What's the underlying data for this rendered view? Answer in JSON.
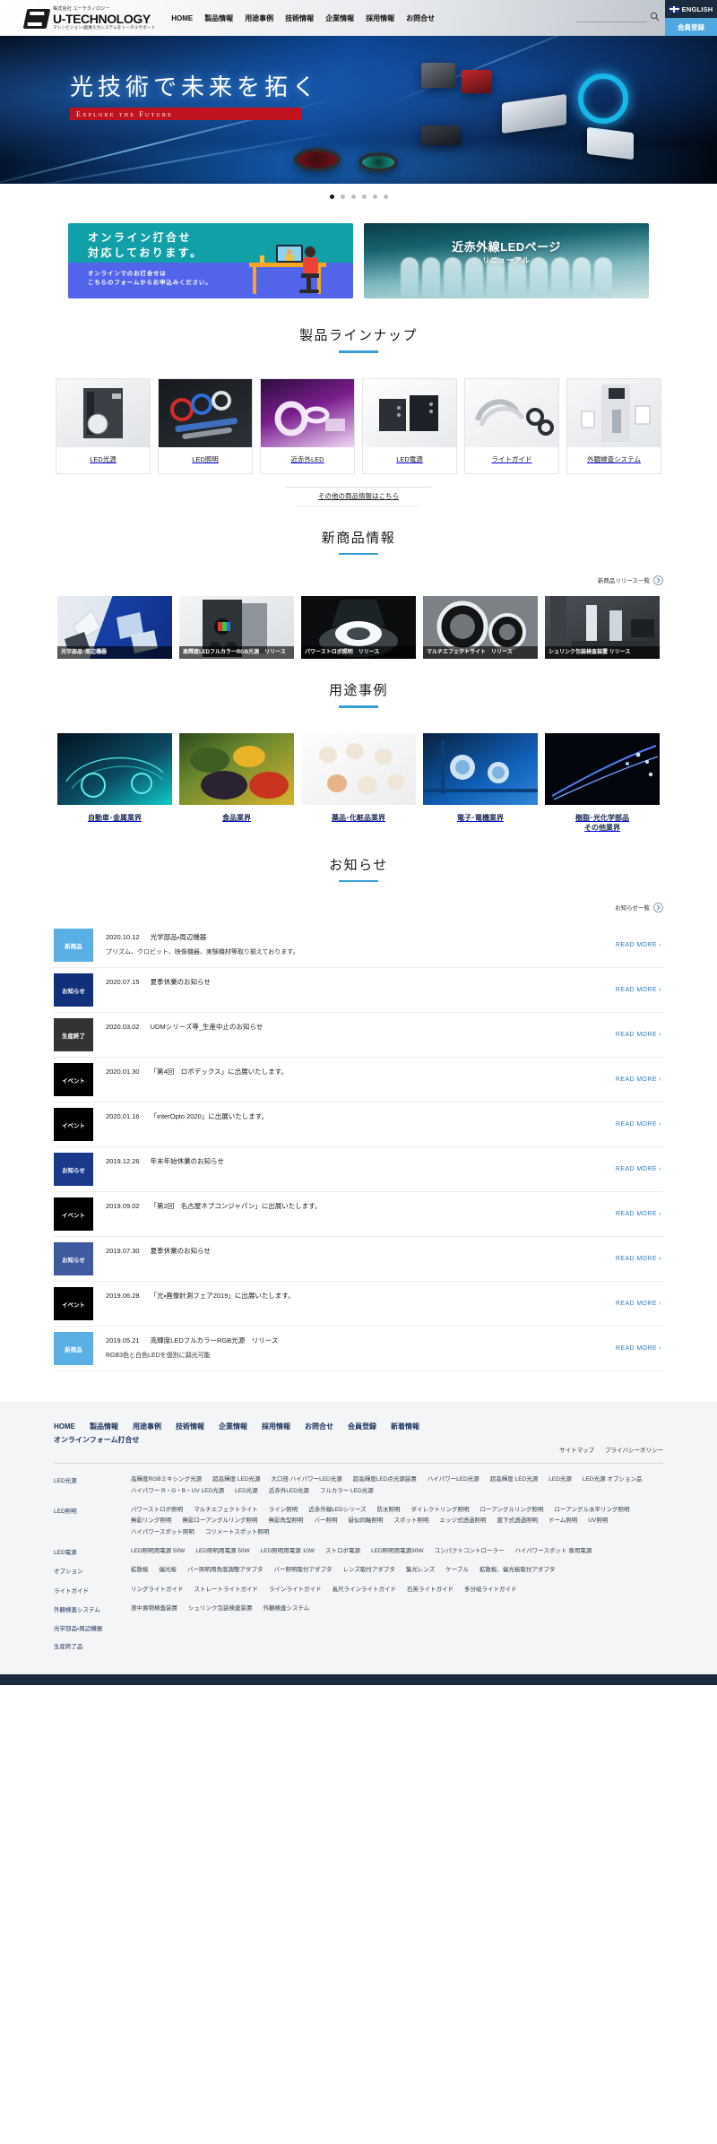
{
  "header": {
    "logo": {
      "kana": "株式会社 ユーテクノロジー",
      "name": "U-TECHNOLOGY",
      "tagline": "マシンビジョン・画像入力システムをトータルサポート"
    },
    "nav": [
      "HOME",
      "製品情報",
      "用途事例",
      "技術情報",
      "企業情報",
      "採用情報",
      "お問合せ"
    ],
    "search": {
      "value": "",
      "placeholder": ""
    },
    "english_label": "ENGLISH",
    "member_label": "会員登録"
  },
  "hero": {
    "title": "光技術で未来を拓く",
    "subtitle": "Explore the Future",
    "slide_count": 6,
    "active_slide": 1
  },
  "banners": [
    {
      "title_line1": "オンライン打合せ",
      "title_line2": "対応しております。",
      "sub_line1": "オンラインでのお打合せは",
      "sub_line2": "こちらのフォームからお申込みください。",
      "color_top": "#12a0a8",
      "color_bottom": "#5264ea"
    },
    {
      "title": "近赤外線LEDページ",
      "subtitle": "リニューアル"
    }
  ],
  "product_lineup": {
    "heading": "製品ラインナップ",
    "items": [
      {
        "label": "LED光源"
      },
      {
        "label": "LED照明"
      },
      {
        "label": "近赤外LED"
      },
      {
        "label": "LED電源"
      },
      {
        "label": "ライトガイド"
      },
      {
        "label": "外観検査システム"
      }
    ],
    "more_label": "その他の商品情報はこちら"
  },
  "new_products": {
    "heading": "新商品情報",
    "list_link": "新商品リリース一覧",
    "items": [
      {
        "caption": "光学部品･周辺機器"
      },
      {
        "caption": "高輝度LEDフルカラーRGB光源　リリース"
      },
      {
        "caption": "パワーストロボ照明　リリース"
      },
      {
        "caption": "マルチエフェクトライト　リリース"
      },
      {
        "caption": "シュリンク包装検査装置 リリース"
      }
    ]
  },
  "use_cases": {
    "heading": "用途事例",
    "items": [
      {
        "label": "自動車･金属業界"
      },
      {
        "label": "食品業界"
      },
      {
        "label": "薬品･化粧品業界"
      },
      {
        "label": "電子･電機業界"
      },
      {
        "label": "樹脂･光化学部品\nその他業界"
      }
    ]
  },
  "news": {
    "heading": "お知らせ",
    "list_link": "お知らせ一覧",
    "read_more": "READ MORE ›",
    "items": [
      {
        "badge": "新商品",
        "badge_color": "#5ab0e4",
        "date": "2020.10.12",
        "title": "光学部品・周辺機器",
        "desc": "プリズム、クロビット、映像機器、実験機材等取り揃えております。"
      },
      {
        "badge": "お知らせ",
        "badge_color": "#10307a",
        "date": "2020.07.15",
        "title": "夏季休業のお知らせ",
        "desc": ""
      },
      {
        "badge": "生産終了",
        "badge_color": "#333333",
        "date": "2020.03.02",
        "title": "UDMシリーズ等_生産中止のお知らせ",
        "desc": ""
      },
      {
        "badge": "イベント",
        "badge_color": "#000000",
        "date": "2020.01.30",
        "title": "「第4回　ロボデックス」に出展いたします。",
        "desc": ""
      },
      {
        "badge": "イベント",
        "badge_color": "#000000",
        "date": "2020.01.16",
        "title": "「interOpto 2020」に出展いたします。",
        "desc": ""
      },
      {
        "badge": "お知らせ",
        "badge_color": "#1b3a8c",
        "date": "2019.12.26",
        "title": "年末年始休業のお知らせ",
        "desc": ""
      },
      {
        "badge": "イベント",
        "badge_color": "#000000",
        "date": "2019.09.02",
        "title": "「第2回　名古屋ネプコンジャパン」に出展いたします。",
        "desc": ""
      },
      {
        "badge": "お知らせ",
        "badge_color": "#3f5a9e",
        "date": "2019.07.30",
        "title": "夏季休業のお知らせ",
        "desc": ""
      },
      {
        "badge": "イベント",
        "badge_color": "#000000",
        "date": "2019.06.28",
        "title": "「光・画像計測フェア2019」に出展いたします。",
        "desc": ""
      },
      {
        "badge": "新商品",
        "badge_color": "#5ab0e4",
        "date": "2019.05.21",
        "title": "高輝度LEDフルカラーRGB光源　リリース",
        "desc": "RGB3色と白色LEDを個別に調光可能"
      }
    ]
  },
  "footer": {
    "nav": [
      "HOME",
      "製品情報",
      "用途事例",
      "技術情報",
      "企業情報",
      "採用情報",
      "お問合せ",
      "会員登録",
      "新着情報",
      "オンラインフォーム打合せ"
    ],
    "policy": [
      "サイトマップ",
      "プライバシーポリシー"
    ],
    "categories": [
      {
        "name": "LED光源",
        "links": [
          "高輝度RGBミキシング光源",
          "超高輝度 LED光源",
          "大口径 ハイパワーLED光源",
          "超高輝度LED点光源装置",
          "ハイパワーLED光源",
          "超高輝度 LED光源",
          "LED光源",
          "LED光源 オプション品",
          "ハイパワー R・G・B・UV LED光源",
          "LED光源",
          "近赤外LED光源",
          "フルカラー LED光源"
        ]
      },
      {
        "name": "LED照明",
        "links": [
          "パワーストロボ照明",
          "マルチエフェクトライト",
          "ライン照明",
          "近赤外線LEDシリーズ",
          "防水照明",
          "ダイレクトリング照明",
          "ローアングルリング照明",
          "ローアングル水平リング照明",
          "無影リング照明",
          "無影ローアングルリング照明",
          "無影角型照明",
          "バー照明",
          "疑似同軸照明",
          "スポット照明",
          "エッジ式透過照明",
          "直下式透過照明",
          "ドーム照明",
          "UV照明",
          "ハイパワースポット照明",
          "コリメートスポット照明"
        ]
      },
      {
        "name": "LED電源",
        "links": [
          "LED照明用電源 50W",
          "LED照明用電源 50W",
          "LED照明用電源 10W",
          "ストロボ電源",
          "LED照明用電源30W",
          "コンパクトコントローラー",
          "ハイパワースポット 専用電源"
        ]
      },
      {
        "name": "オプション",
        "links": [
          "拡散板",
          "偏光板",
          "バー照明用角度調整アダプタ",
          "バー照明取付アダプタ",
          "レンズ取付アダプタ",
          "集光レンズ",
          "ケーブル",
          "拡散板、偏光板取付アダプタ"
        ]
      },
      {
        "name": "ライトガイド",
        "links": [
          "リングライトガイド",
          "ストレートライトガイド",
          "ラインライトガイド",
          "長尺ラインライトガイド",
          "石英ライトガイド",
          "多分岐ライトガイド"
        ]
      },
      {
        "name": "外観検査システム",
        "links": [
          "液中異物検査装置",
          "シュリンク包装検査装置",
          "外観検査システム"
        ]
      },
      {
        "name": "光学部品・周辺機器",
        "links": []
      },
      {
        "name": "生産終了品",
        "links": []
      }
    ]
  }
}
